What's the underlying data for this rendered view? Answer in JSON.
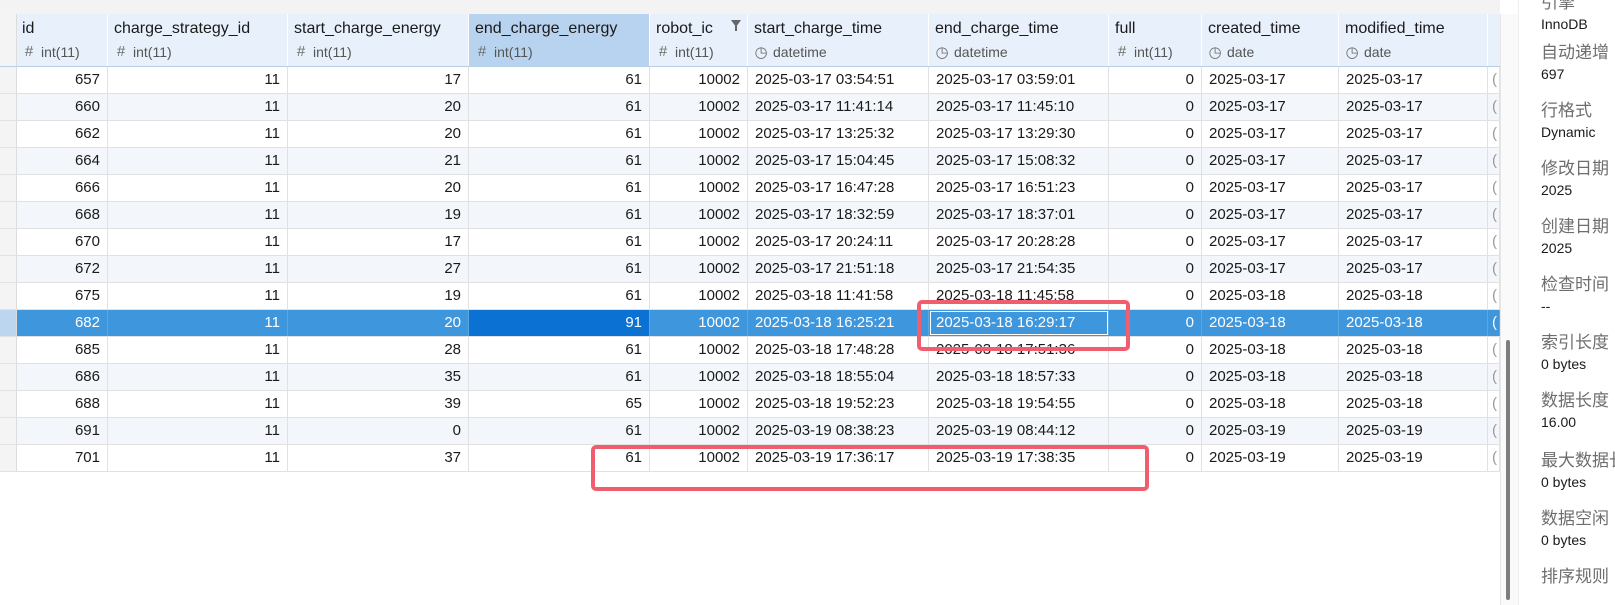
{
  "columns": [
    {
      "name": "id",
      "type": "int(11)",
      "type_icon": "hash-icon"
    },
    {
      "name": "charge_strategy_id",
      "type": "int(11)",
      "type_icon": "hash-icon"
    },
    {
      "name": "start_charge_energy",
      "type": "int(11)",
      "type_icon": "hash-icon"
    },
    {
      "name": "end_charge_energy",
      "type": "int(11)",
      "type_icon": "hash-icon",
      "selected": true
    },
    {
      "name": "robot_ic",
      "type": "int(11)",
      "type_icon": "hash-icon",
      "filter": true
    },
    {
      "name": "start_charge_time",
      "type": "datetime",
      "type_icon": "clock-icon"
    },
    {
      "name": "end_charge_time",
      "type": "datetime",
      "type_icon": "clock-icon"
    },
    {
      "name": "full",
      "type": "int(11)",
      "type_icon": "hash-icon"
    },
    {
      "name": "created_time",
      "type": "date",
      "type_icon": "clock-icon"
    },
    {
      "name": "modified_time",
      "type": "date",
      "type_icon": "clock-icon"
    }
  ],
  "rows": [
    [
      "657",
      "11",
      "17",
      "61",
      "10002",
      "2025-03-17 03:54:51",
      "2025-03-17 03:59:01",
      "0",
      "2025-03-17",
      "2025-03-17",
      "("
    ],
    [
      "660",
      "11",
      "20",
      "61",
      "10002",
      "2025-03-17 11:41:14",
      "2025-03-17 11:45:10",
      "0",
      "2025-03-17",
      "2025-03-17",
      "("
    ],
    [
      "662",
      "11",
      "20",
      "61",
      "10002",
      "2025-03-17 13:25:32",
      "2025-03-17 13:29:30",
      "0",
      "2025-03-17",
      "2025-03-17",
      "("
    ],
    [
      "664",
      "11",
      "21",
      "61",
      "10002",
      "2025-03-17 15:04:45",
      "2025-03-17 15:08:32",
      "0",
      "2025-03-17",
      "2025-03-17",
      "("
    ],
    [
      "666",
      "11",
      "20",
      "61",
      "10002",
      "2025-03-17 16:47:28",
      "2025-03-17 16:51:23",
      "0",
      "2025-03-17",
      "2025-03-17",
      "("
    ],
    [
      "668",
      "11",
      "19",
      "61",
      "10002",
      "2025-03-17 18:32:59",
      "2025-03-17 18:37:01",
      "0",
      "2025-03-17",
      "2025-03-17",
      "("
    ],
    [
      "670",
      "11",
      "17",
      "61",
      "10002",
      "2025-03-17 20:24:11",
      "2025-03-17 20:28:28",
      "0",
      "2025-03-17",
      "2025-03-17",
      "("
    ],
    [
      "672",
      "11",
      "27",
      "61",
      "10002",
      "2025-03-17 21:51:18",
      "2025-03-17 21:54:35",
      "0",
      "2025-03-17",
      "2025-03-17",
      "("
    ],
    [
      "675",
      "11",
      "19",
      "61",
      "10002",
      "2025-03-18 11:41:58",
      "2025-03-18 11:45:58",
      "0",
      "2025-03-18",
      "2025-03-18",
      "("
    ],
    [
      "682",
      "11",
      "20",
      "91",
      "10002",
      "2025-03-18 16:25:21",
      "2025-03-18 16:29:17",
      "0",
      "2025-03-18",
      "2025-03-18",
      "("
    ],
    [
      "685",
      "11",
      "28",
      "61",
      "10002",
      "2025-03-18 17:48:28",
      "2025-03-18 17:51:36",
      "0",
      "2025-03-18",
      "2025-03-18",
      "("
    ],
    [
      "686",
      "11",
      "35",
      "61",
      "10002",
      "2025-03-18 18:55:04",
      "2025-03-18 18:57:33",
      "0",
      "2025-03-18",
      "2025-03-18",
      "("
    ],
    [
      "688",
      "11",
      "39",
      "65",
      "10002",
      "2025-03-18 19:52:23",
      "2025-03-18 19:54:55",
      "0",
      "2025-03-18",
      "2025-03-18",
      "("
    ],
    [
      "691",
      "11",
      "0",
      "61",
      "10002",
      "2025-03-19 08:38:23",
      "2025-03-19 08:44:12",
      "0",
      "2025-03-19",
      "2025-03-19",
      "("
    ],
    [
      "701",
      "11",
      "37",
      "61",
      "10002",
      "2025-03-19 17:36:17",
      "2025-03-19 17:38:35",
      "0",
      "2025-03-19",
      "2025-03-19",
      "("
    ]
  ],
  "selected_row_index": 9,
  "side_panel": [
    {
      "label": "引擎",
      "value": "InnoDB"
    },
    {
      "label": "自动递增",
      "value": "697"
    },
    {
      "label": "行格式",
      "value": "Dynamic"
    },
    {
      "label": "修改日期",
      "value": "2025"
    },
    {
      "label": "创建日期",
      "value": "2025"
    },
    {
      "label": "检查时间",
      "value": "--"
    },
    {
      "label": "索引长度",
      "value": "0 bytes"
    },
    {
      "label": "数据长度",
      "value": "16.00"
    },
    {
      "label": "最大数据长度",
      "value": "0 bytes"
    },
    {
      "label": "数据空闲",
      "value": "0 bytes"
    },
    {
      "label": "排序规则",
      "value": ""
    }
  ],
  "colors": {
    "header_bg": "#e8f1fb",
    "selected_row": "#3e96dd",
    "selected_cell": "#0b72d4",
    "annotation_red": "#f05d6e"
  }
}
